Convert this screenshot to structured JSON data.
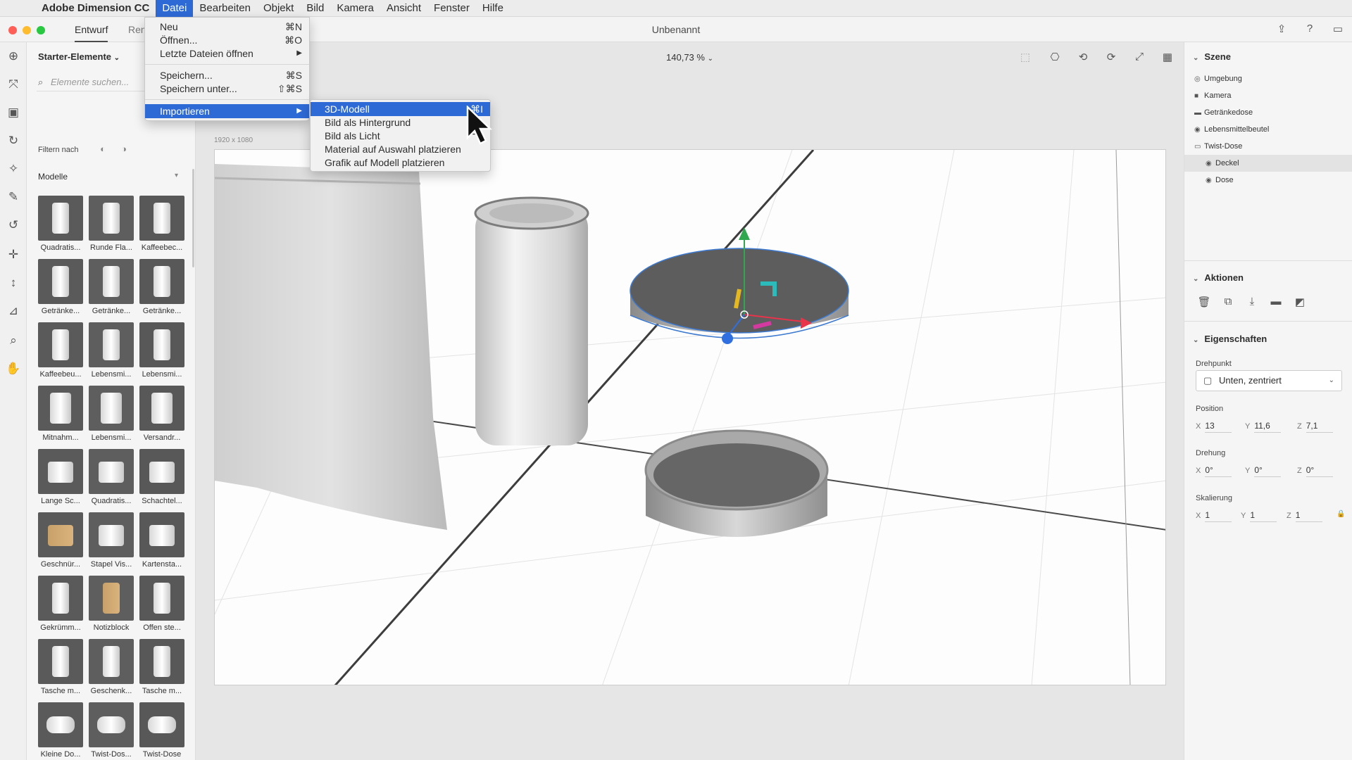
{
  "menubar": {
    "app_name": "Adobe Dimension CC",
    "items": [
      "Datei",
      "Bearbeiten",
      "Objekt",
      "Bild",
      "Kamera",
      "Ansicht",
      "Fenster",
      "Hilfe"
    ],
    "active": "Datei"
  },
  "titlebar": {
    "tab_design": "Entwurf",
    "tab_render": "Ren",
    "document_title": "Unbenannt"
  },
  "file_menu": {
    "new": {
      "label": "Neu",
      "shortcut": "⌘N"
    },
    "open": {
      "label": "Öffnen...",
      "shortcut": "⌘O"
    },
    "recent": {
      "label": "Letzte Dateien öffnen",
      "arrow": "▶"
    },
    "save": {
      "label": "Speichern...",
      "shortcut": "⌘S"
    },
    "save_as": {
      "label": "Speichern unter...",
      "shortcut": "⇧⌘S"
    },
    "import": {
      "label": "Importieren",
      "arrow": "▶"
    }
  },
  "import_submenu": {
    "model": {
      "label": "3D-Modell",
      "shortcut": "⌘I"
    },
    "background": {
      "label": "Bild als Hintergrund",
      "shortcut": "⇧"
    },
    "light": {
      "label": "Bild als Licht",
      "shortcut": "⌥"
    },
    "material": {
      "label": "Material auf Auswahl platzieren"
    },
    "graphic": {
      "label": "Grafik auf Modell platzieren"
    }
  },
  "assets": {
    "header": "Starter-Elemente",
    "search_placeholder": "Elemente suchen...",
    "filter_label": "Filtern nach",
    "section": "Modelle",
    "models": [
      "Quadratis...",
      "Runde Fla...",
      "Kaffeebec...",
      "Getränke...",
      "Getränke...",
      "Getränke...",
      "Kaffeebeu...",
      "Lebensmi...",
      "Lebensmi...",
      "Mitnahm...",
      "Lebensmi...",
      "Versandr...",
      "Lange Sc...",
      "Quadratis...",
      "Schachtel...",
      "Geschnür...",
      "Stapel Vis...",
      "Kartensta...",
      "Gekrümm...",
      "Notizblock",
      "Offen ste...",
      "Tasche m...",
      "Geschenk...",
      "Tasche m...",
      "Kleine Do...",
      "Twist-Dos...",
      "Twist-Dose"
    ]
  },
  "viewport": {
    "zoom": "140,73 %",
    "dimensions": "1920 x 1080"
  },
  "scene": {
    "header": "Szene",
    "items": [
      {
        "label": "Umgebung",
        "icon": "environment-icon"
      },
      {
        "label": "Kamera",
        "icon": "camera-icon"
      },
      {
        "label": "Getränkedose",
        "icon": "folder-icon"
      },
      {
        "label": "Lebensmittelbeutel",
        "icon": "model-icon"
      },
      {
        "label": "Twist-Dose",
        "icon": "folder-open-icon"
      },
      {
        "label": "Deckel",
        "icon": "model-icon",
        "selected": true
      },
      {
        "label": "Dose",
        "icon": "model-icon"
      }
    ]
  },
  "actions": {
    "header": "Aktionen"
  },
  "properties": {
    "header": "Eigenschaften",
    "pivot_label": "Drehpunkt",
    "pivot_value": "Unten, zentriert",
    "position_label": "Position",
    "position": {
      "x": "13",
      "y": "11,6",
      "z": "7,1"
    },
    "rotation_label": "Drehung",
    "rotation": {
      "x": "0°",
      "y": "0°",
      "z": "0°"
    },
    "scale_label": "Skalierung",
    "scale": {
      "x": "1",
      "y": "1",
      "z": "1"
    }
  },
  "colors": {
    "accent": "#2e6ad6",
    "gizmo_x": "#e8334a",
    "gizmo_y": "#2fa84f",
    "gizmo_z": "#2f6fe0"
  }
}
